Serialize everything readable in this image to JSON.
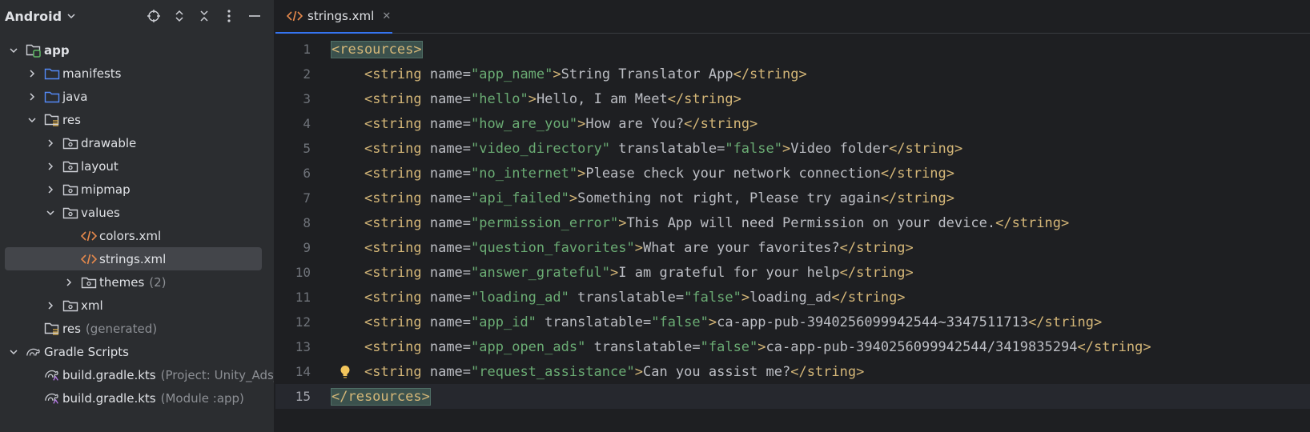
{
  "project_panel": {
    "title": "Android",
    "tree": [
      {
        "label": "app",
        "bold": true,
        "indent": 0,
        "arrow": "down",
        "icon": "module-folder-icon"
      },
      {
        "label": "manifests",
        "indent": 1,
        "arrow": "right",
        "icon": "folder-icon"
      },
      {
        "label": "java",
        "indent": 1,
        "arrow": "right",
        "icon": "folder-icon"
      },
      {
        "label": "res",
        "indent": 1,
        "arrow": "down",
        "icon": "res-folder-icon"
      },
      {
        "label": "drawable",
        "indent": 2,
        "arrow": "right",
        "icon": "package-folder-icon"
      },
      {
        "label": "layout",
        "indent": 2,
        "arrow": "right",
        "icon": "package-folder-icon"
      },
      {
        "label": "mipmap",
        "indent": 2,
        "arrow": "right",
        "icon": "package-folder-icon"
      },
      {
        "label": "values",
        "indent": 2,
        "arrow": "down",
        "icon": "package-folder-icon"
      },
      {
        "label": "colors.xml",
        "indent": 3,
        "arrow": "none",
        "icon": "xml-file-icon"
      },
      {
        "label": "strings.xml",
        "indent": 3,
        "arrow": "none",
        "icon": "xml-file-icon",
        "selected": true
      },
      {
        "label": "themes",
        "hint": "(2)",
        "indent": 3,
        "arrow": "right",
        "icon": "package-folder-icon"
      },
      {
        "label": "xml",
        "indent": 2,
        "arrow": "right",
        "icon": "package-folder-icon"
      },
      {
        "label": "res",
        "hint": "(generated)",
        "indent": 1,
        "arrow": "none",
        "icon": "res-folder-icon"
      },
      {
        "label": "Gradle Scripts",
        "indent": 0,
        "arrow": "down",
        "icon": "gradle-icon"
      },
      {
        "label": "build.gradle.kts",
        "hint": "(Project: Unity_Ads_",
        "indent": 1,
        "arrow": "none",
        "icon": "gradle-file-icon"
      },
      {
        "label": "build.gradle.kts",
        "hint": "(Module :app)",
        "indent": 1,
        "arrow": "none",
        "icon": "gradle-file-icon"
      }
    ]
  },
  "editor": {
    "tab_label": "strings.xml",
    "current_line": 15,
    "lines": [
      {
        "n": "1",
        "tokens": [
          {
            "t": "tag",
            "v": "<resources>",
            "hl": true
          }
        ]
      },
      {
        "n": "2",
        "tokens": [
          {
            "t": "txt",
            "v": "    "
          },
          {
            "t": "tag",
            "v": "<string "
          },
          {
            "t": "attr",
            "v": "name="
          },
          {
            "t": "val",
            "v": "\"app_name\""
          },
          {
            "t": "tag",
            "v": ">"
          },
          {
            "t": "txt",
            "v": "String Translator App"
          },
          {
            "t": "tag",
            "v": "</string>"
          }
        ]
      },
      {
        "n": "3",
        "tokens": [
          {
            "t": "txt",
            "v": "    "
          },
          {
            "t": "tag",
            "v": "<string "
          },
          {
            "t": "attr",
            "v": "name="
          },
          {
            "t": "val",
            "v": "\"hello\""
          },
          {
            "t": "tag",
            "v": ">"
          },
          {
            "t": "txt",
            "v": "Hello, I am Meet"
          },
          {
            "t": "tag",
            "v": "</string>"
          }
        ]
      },
      {
        "n": "4",
        "tokens": [
          {
            "t": "txt",
            "v": "    "
          },
          {
            "t": "tag",
            "v": "<string "
          },
          {
            "t": "attr",
            "v": "name="
          },
          {
            "t": "val",
            "v": "\"how_are_you\""
          },
          {
            "t": "tag",
            "v": ">"
          },
          {
            "t": "txt",
            "v": "How are You?"
          },
          {
            "t": "tag",
            "v": "</string>"
          }
        ]
      },
      {
        "n": "5",
        "tokens": [
          {
            "t": "txt",
            "v": "    "
          },
          {
            "t": "tag",
            "v": "<string "
          },
          {
            "t": "attr",
            "v": "name="
          },
          {
            "t": "val",
            "v": "\"video_directory\""
          },
          {
            "t": "attr",
            "v": " translatable="
          },
          {
            "t": "val",
            "v": "\"false\""
          },
          {
            "t": "tag",
            "v": ">"
          },
          {
            "t": "txt",
            "v": "Video folder"
          },
          {
            "t": "tag",
            "v": "</string>"
          }
        ]
      },
      {
        "n": "6",
        "tokens": [
          {
            "t": "txt",
            "v": "    "
          },
          {
            "t": "tag",
            "v": "<string "
          },
          {
            "t": "attr",
            "v": "name="
          },
          {
            "t": "val",
            "v": "\"no_internet\""
          },
          {
            "t": "tag",
            "v": ">"
          },
          {
            "t": "txt",
            "v": "Please check your network connection"
          },
          {
            "t": "tag",
            "v": "</string>"
          }
        ]
      },
      {
        "n": "7",
        "tokens": [
          {
            "t": "txt",
            "v": "    "
          },
          {
            "t": "tag",
            "v": "<string "
          },
          {
            "t": "attr",
            "v": "name="
          },
          {
            "t": "val",
            "v": "\"api_failed\""
          },
          {
            "t": "tag",
            "v": ">"
          },
          {
            "t": "txt",
            "v": "Something not right, Please try again"
          },
          {
            "t": "tag",
            "v": "</string>"
          }
        ]
      },
      {
        "n": "8",
        "tokens": [
          {
            "t": "txt",
            "v": "    "
          },
          {
            "t": "tag",
            "v": "<string "
          },
          {
            "t": "attr",
            "v": "name="
          },
          {
            "t": "val",
            "v": "\"permission_error\""
          },
          {
            "t": "tag",
            "v": ">"
          },
          {
            "t": "txt",
            "v": "This App will need Permission on your device."
          },
          {
            "t": "tag",
            "v": "</string>"
          }
        ]
      },
      {
        "n": "9",
        "tokens": [
          {
            "t": "txt",
            "v": "    "
          },
          {
            "t": "tag",
            "v": "<string "
          },
          {
            "t": "attr",
            "v": "name="
          },
          {
            "t": "val",
            "v": "\"question_favorites\""
          },
          {
            "t": "tag",
            "v": ">"
          },
          {
            "t": "txt",
            "v": "What are your favorites?"
          },
          {
            "t": "tag",
            "v": "</string>"
          }
        ]
      },
      {
        "n": "10",
        "tokens": [
          {
            "t": "txt",
            "v": "    "
          },
          {
            "t": "tag",
            "v": "<string "
          },
          {
            "t": "attr",
            "v": "name="
          },
          {
            "t": "val",
            "v": "\"answer_grateful\""
          },
          {
            "t": "tag",
            "v": ">"
          },
          {
            "t": "txt",
            "v": "I am grateful for your help"
          },
          {
            "t": "tag",
            "v": "</string>"
          }
        ]
      },
      {
        "n": "11",
        "tokens": [
          {
            "t": "txt",
            "v": "    "
          },
          {
            "t": "tag",
            "v": "<string "
          },
          {
            "t": "attr",
            "v": "name="
          },
          {
            "t": "val",
            "v": "\"loading_ad\""
          },
          {
            "t": "attr",
            "v": " translatable="
          },
          {
            "t": "val",
            "v": "\"false\""
          },
          {
            "t": "tag",
            "v": ">"
          },
          {
            "t": "txt",
            "v": "loading_ad"
          },
          {
            "t": "tag",
            "v": "</string>"
          }
        ]
      },
      {
        "n": "12",
        "tokens": [
          {
            "t": "txt",
            "v": "    "
          },
          {
            "t": "tag",
            "v": "<string "
          },
          {
            "t": "attr",
            "v": "name="
          },
          {
            "t": "val",
            "v": "\"app_id\""
          },
          {
            "t": "attr",
            "v": " translatable="
          },
          {
            "t": "val",
            "v": "\"false\""
          },
          {
            "t": "tag",
            "v": ">"
          },
          {
            "t": "txt",
            "v": "ca-app-pub-3940256099942544~3347511713"
          },
          {
            "t": "tag",
            "v": "</string>"
          }
        ]
      },
      {
        "n": "13",
        "tokens": [
          {
            "t": "txt",
            "v": "    "
          },
          {
            "t": "tag",
            "v": "<string "
          },
          {
            "t": "attr",
            "v": "name="
          },
          {
            "t": "val",
            "v": "\"app_open_ads\""
          },
          {
            "t": "attr",
            "v": " translatable="
          },
          {
            "t": "val",
            "v": "\"false\""
          },
          {
            "t": "tag",
            "v": ">"
          },
          {
            "t": "txt",
            "v": "ca-app-pub-3940256099942544/3419835294"
          },
          {
            "t": "tag",
            "v": "</string>"
          }
        ]
      },
      {
        "n": "14",
        "bulb": true,
        "tokens": [
          {
            "t": "txt",
            "v": "    "
          },
          {
            "t": "tag",
            "v": "<string "
          },
          {
            "t": "attr",
            "v": "name="
          },
          {
            "t": "val",
            "v": "\"request_assistance\""
          },
          {
            "t": "tag",
            "v": ">"
          },
          {
            "t": "txt",
            "v": "Can you assist me?"
          },
          {
            "t": "tag",
            "v": "</string>"
          }
        ]
      },
      {
        "n": "15",
        "tokens": [
          {
            "t": "tag",
            "v": "</resources>",
            "hl": true
          }
        ]
      }
    ]
  },
  "colors": {
    "tag": "#d5b778",
    "attr": "#bcbec4",
    "value": "#6aab73",
    "accent": "#3574f0"
  }
}
